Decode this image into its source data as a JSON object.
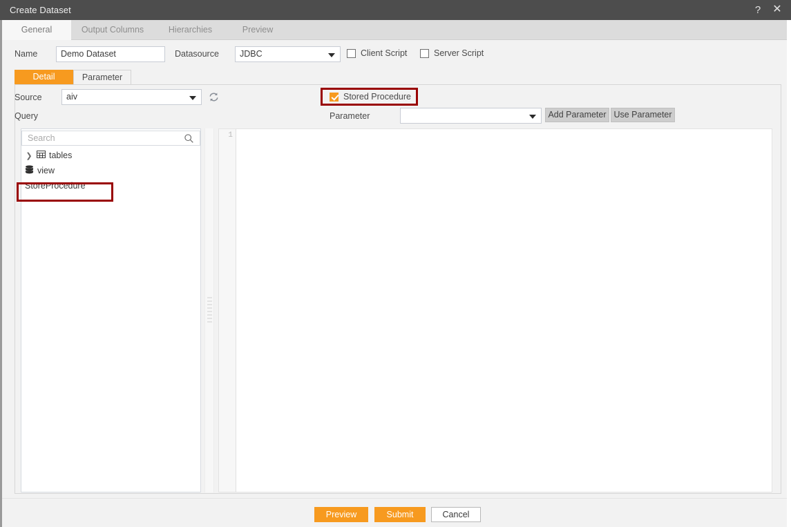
{
  "window": {
    "title": "Create Dataset",
    "help_icon": "?",
    "close_icon": "✕"
  },
  "tabs": [
    {
      "label": "General",
      "active": true
    },
    {
      "label": "Output Columns",
      "active": false
    },
    {
      "label": "Hierarchies",
      "active": false
    },
    {
      "label": "Preview",
      "active": false
    }
  ],
  "general": {
    "name_label": "Name",
    "name_value": "Demo Dataset",
    "datasource_label": "Datasource",
    "datasource_value": "JDBC",
    "client_script_label": "Client Script",
    "client_script_checked": false,
    "server_script_label": "Server Script",
    "server_script_checked": false
  },
  "detail_tabs": [
    {
      "label": "Detail",
      "active": true
    },
    {
      "label": "Parameter",
      "active": false
    }
  ],
  "detail": {
    "source_label": "Source",
    "source_value": "aiv",
    "refresh_icon": "refresh-icon",
    "stored_procedure_label": "Stored Procedure",
    "stored_procedure_checked": true,
    "query_label": "Query",
    "parameter_label": "Parameter",
    "parameter_value": "",
    "add_parameter_label": "Add Parameter",
    "use_parameter_label": "Use Parameter"
  },
  "tree": {
    "search_placeholder": "Search",
    "search_value": "",
    "nodes": [
      {
        "label": "tables",
        "icon": "table-icon",
        "expandable": true,
        "highlighted": false
      },
      {
        "label": "view",
        "icon": "database-icon",
        "expandable": false,
        "highlighted": false
      },
      {
        "label": "StoreProcedure",
        "icon": "none",
        "expandable": false,
        "highlighted": true
      }
    ]
  },
  "editor": {
    "line_numbers": [
      "1"
    ],
    "content": ""
  },
  "footer": {
    "preview_label": "Preview",
    "submit_label": "Submit",
    "cancel_label": "Cancel"
  },
  "colors": {
    "accent": "#f79a1f",
    "titlebar": "#4d4d4d",
    "highlight_box": "#990000",
    "panel_bg": "#f2f2f2",
    "tabbar_bg": "#dcdcdc"
  }
}
